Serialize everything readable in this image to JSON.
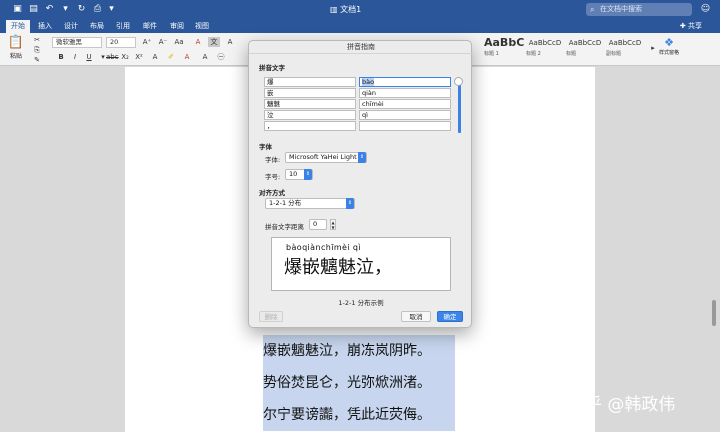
{
  "titlebar": {
    "doc_title": "文档1",
    "search_placeholder": "在文档中搜索"
  },
  "menu": {
    "tabs": [
      "开始",
      "插入",
      "设计",
      "布局",
      "引用",
      "邮件",
      "审阅",
      "视图"
    ],
    "share": "共享"
  },
  "ribbon": {
    "paste": "粘贴",
    "font_name": "微软雅黑",
    "font_size": "20",
    "styles": [
      {
        "sample": "AaBbC",
        "name": "标题 1"
      },
      {
        "sample": "AaBbCcD",
        "name": "标题 2"
      },
      {
        "sample": "AaBbCcD",
        "name": "标题"
      },
      {
        "sample": "AaBbCcD",
        "name": "副标题"
      }
    ],
    "styles_pane": "样式窗格"
  },
  "document": {
    "lines": [
      "爆嵌魑魅泣，崩冻岚阴昨。",
      "势俗焚昆仑，光弥焮洲渚。",
      "尔宁要谤讟，凭此近荧侮。"
    ]
  },
  "dialog": {
    "title": "拼音指南",
    "section_pinyin": "拼音文字",
    "base_chars": [
      "爆",
      "嵌",
      "魑魅",
      "泣",
      "，"
    ],
    "ruby_text": [
      "bào",
      "qiàn",
      "chīmèi",
      "qì",
      ""
    ],
    "section_font": "字体",
    "font_label": "字体:",
    "font_value": "Microsoft YaHei Light",
    "size_label": "字号:",
    "size_value": "10",
    "section_align": "对齐方式",
    "align_value": "1-2-1 分布",
    "offset_label": "拼音文字距离",
    "offset_value": "0",
    "preview_ruby": "bàoqiànchīmèi qì",
    "preview_text": "爆嵌魑魅泣，",
    "preview_caption": "1-2-1 分布示例",
    "delete_button": "删除",
    "cancel_button": "取消",
    "ok_button": "确定"
  },
  "watermark": "知乎 @韩政伟",
  "colors": {
    "titlebar": "#2b579a",
    "accent_blue": "#3c82e6",
    "highlight": "#c7d6ee"
  }
}
